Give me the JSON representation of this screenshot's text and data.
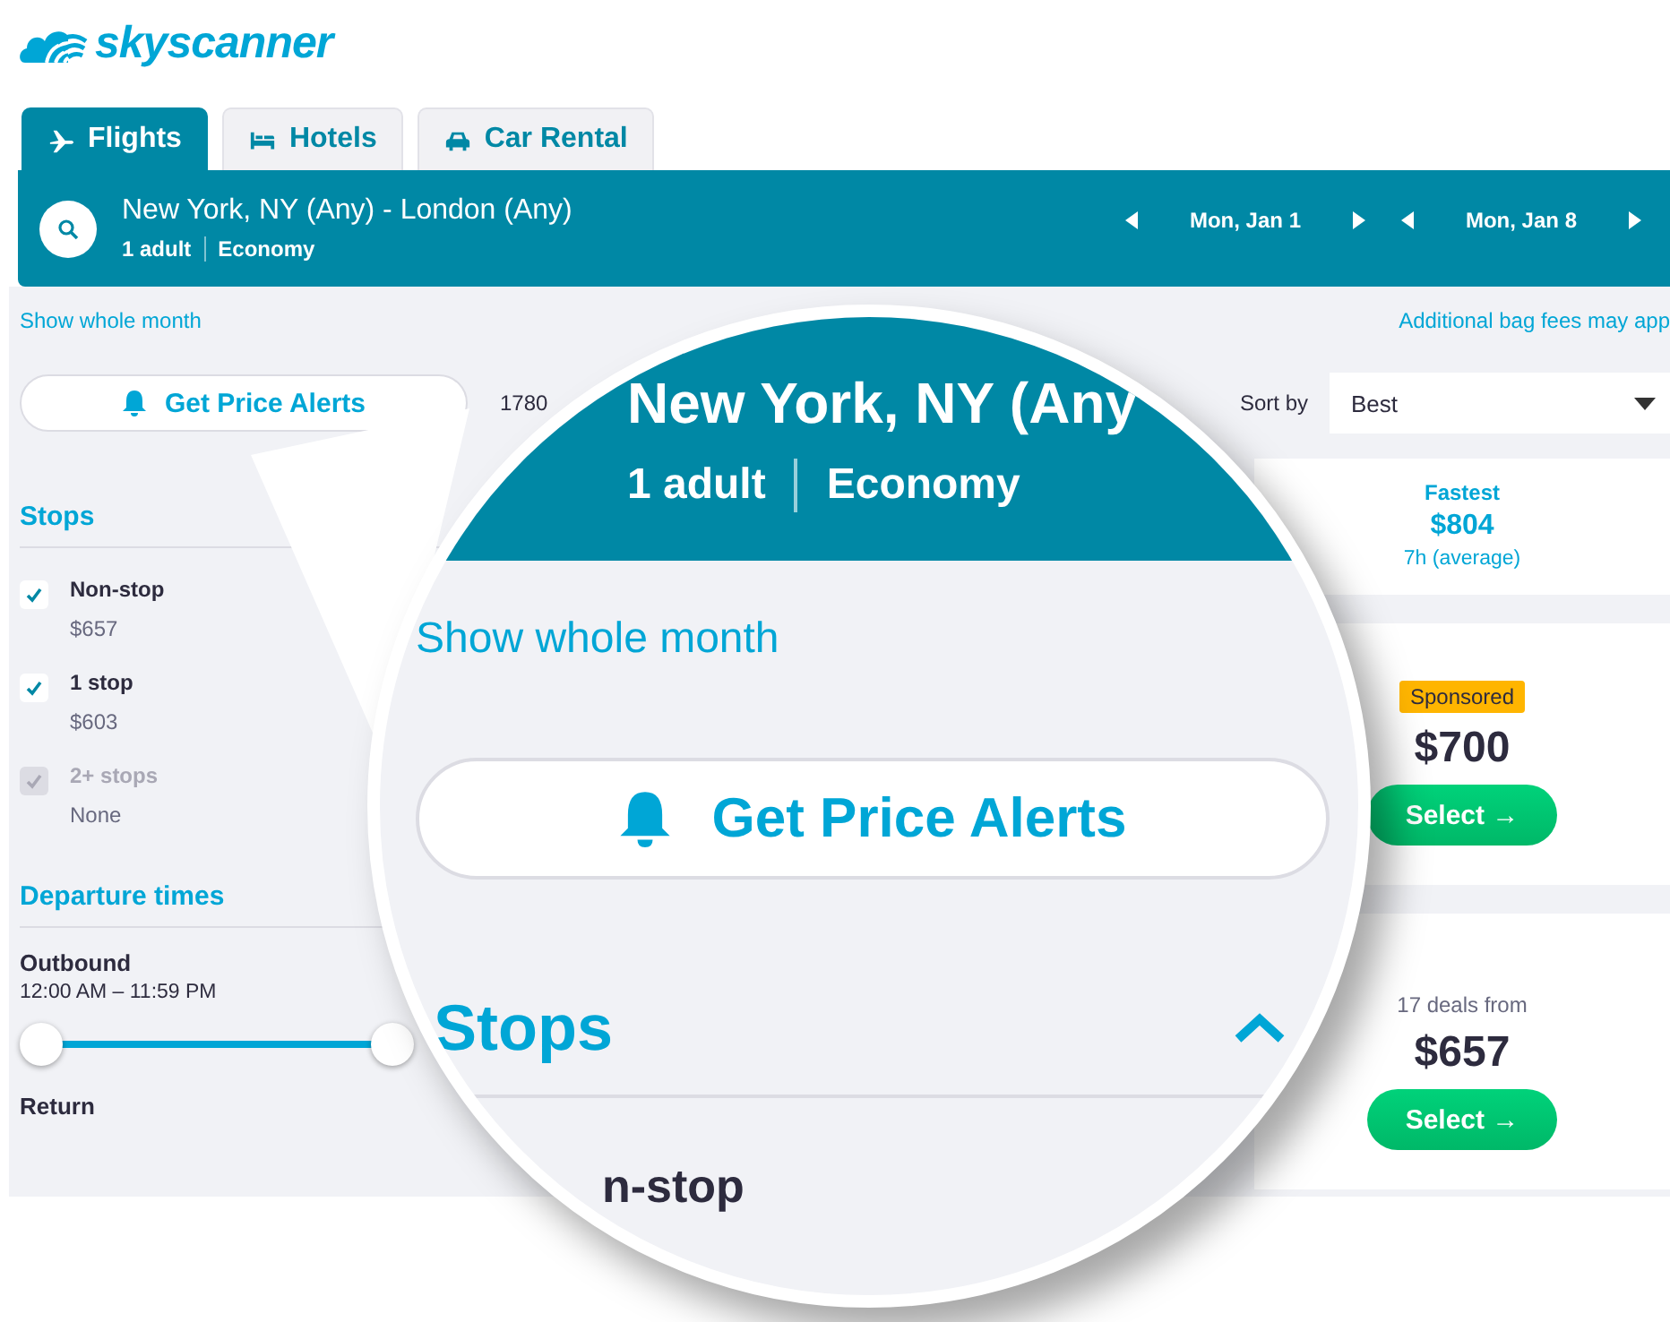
{
  "logo": {
    "text": "skyscanner"
  },
  "tabs": [
    {
      "label": "Flights",
      "kind": "flights",
      "selected": true
    },
    {
      "label": "Hotels",
      "kind": "hotels",
      "selected": false
    },
    {
      "label": "Car Rental",
      "kind": "cars",
      "selected": false
    }
  ],
  "search": {
    "route": "New York, NY (Any) - London (Any)",
    "travellers": "1 adult",
    "cabin": "Economy",
    "dates": [
      "Mon, Jan 1",
      "Mon, Jan 8"
    ]
  },
  "links": {
    "whole_month": "Show whole month",
    "bag_fees": "Additional bag fees may app"
  },
  "price_alerts": "Get Price Alerts",
  "result_count": "1780",
  "sort": {
    "label": "Sort by",
    "value": "Best"
  },
  "filters": {
    "stops": {
      "title": "Stops",
      "items": [
        {
          "label": "Non-stop",
          "price": "$657",
          "checked": true,
          "disabled": false
        },
        {
          "label": "1 stop",
          "price": "$603",
          "checked": true,
          "disabled": false
        },
        {
          "label": "2+ stops",
          "price": "None",
          "checked": true,
          "disabled": true
        }
      ]
    },
    "departure": {
      "title": "Departure times",
      "outbound_label": "Outbound",
      "outbound_range": "12:00 AM – 11:59 PM",
      "level": 1,
      "return_label": "Return"
    }
  },
  "summary": {
    "label": "Fastest",
    "price": "$804",
    "detail": "7h (average)"
  },
  "results": [
    {
      "badge": "Sponsored",
      "price": "$700",
      "action": "Select →"
    },
    {
      "note": "17 deals from",
      "price": "$657",
      "action": "Select →"
    }
  ],
  "magnifier": {
    "route": "New York, NY (Any",
    "travellers": "1 adult",
    "cabin": "Economy",
    "link": "Show whole month",
    "button": "Get Price Alerts",
    "section": "Stops",
    "item": "n-stop"
  }
}
